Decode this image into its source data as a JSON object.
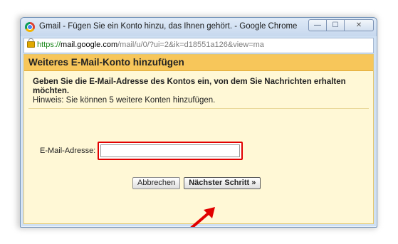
{
  "window": {
    "title": "Gmail - Fügen Sie ein Konto hinzu, das Ihnen gehört. - Google Chrome",
    "controls": {
      "minimize": "—",
      "maximize": "☐",
      "close": "✕"
    }
  },
  "addressbar": {
    "scheme": "https://",
    "host": "mail.google.com",
    "path": "/mail/u/0/?ui=2&ik=d18551a126&view=ma"
  },
  "dialog": {
    "title": "Weiteres E-Mail-Konto hinzufügen",
    "instruction": "Geben Sie die E-Mail-Adresse des Kontos ein, von dem Sie Nachrichten erhalten möchten.",
    "hint": "Hinweis: Sie können 5 weitere Konten hinzufügen.",
    "email_label": "E-Mail-Adresse:",
    "email_value": "",
    "cancel_label": "Abbrechen",
    "next_label": "Nächster Schritt »"
  },
  "colors": {
    "header_bg": "#f7c65a",
    "dialog_bg": "#fff8d6",
    "highlight": "#e10000"
  },
  "icons": [
    "chrome-logo-icon",
    "lock-icon",
    "red-arrow-icon"
  ]
}
